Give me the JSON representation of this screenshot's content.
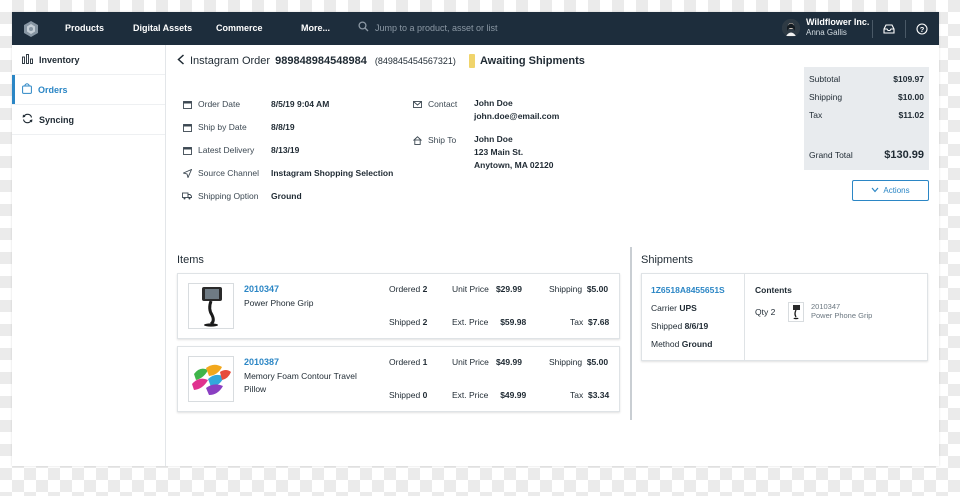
{
  "topbar": {
    "nav": [
      "Products",
      "Digital Assets",
      "Commerce",
      "More..."
    ],
    "search_placeholder": "Jump to a product, asset or list",
    "account_name": "Wildflower Inc.",
    "account_user": "Anna Gallis",
    "icons": [
      "logo-icon",
      "search-icon",
      "inbox-icon",
      "help-icon"
    ]
  },
  "sidebar": {
    "items": [
      {
        "label": "Inventory",
        "icon": "inventory-icon"
      },
      {
        "label": "Orders",
        "icon": "orders-bag-icon",
        "active": true
      },
      {
        "label": "Syncing",
        "icon": "sync-icon"
      }
    ]
  },
  "order": {
    "prefix": "Instagram Order",
    "number": "989848984548984",
    "alt_number": "(849845454567321)",
    "status": "Awaiting Shipments",
    "status_color": "#f0d46b",
    "details": [
      {
        "label": "Order Date",
        "value": "8/5/19 9:04 AM",
        "icon": "calendar-icon"
      },
      {
        "label": "Ship by Date",
        "value": "8/8/19",
        "icon": "calendar-icon"
      },
      {
        "label": "Latest Delivery",
        "value": "8/13/19",
        "icon": "calendar-icon"
      },
      {
        "label": "Source Channel",
        "value": "Instagram Shopping Selection",
        "icon": "send-icon"
      },
      {
        "label": "Shipping Option",
        "value": "Ground",
        "icon": "truck-icon"
      }
    ],
    "contact": {
      "label": "Contact",
      "name": "John Doe",
      "email": "john.doe@email.com"
    },
    "ship_to": {
      "label": "Ship To",
      "name": "John Doe",
      "street": "123 Main St.",
      "city": "Anytown, MA 02120"
    }
  },
  "totals": {
    "subtotal_label": "Subtotal",
    "subtotal": "$109.97",
    "shipping_label": "Shipping",
    "shipping": "$10.00",
    "tax_label": "Tax",
    "tax": "$11.02",
    "grand_label": "Grand Total",
    "grand": "$130.99"
  },
  "actions_label": "Actions",
  "items_title": "Items",
  "items": [
    {
      "sku": "2010347",
      "name": "Power Phone Grip",
      "ordered_label": "Ordered",
      "ordered": "2",
      "shipped_label": "Shipped",
      "shipped": "2",
      "unit_label": "Unit Price",
      "unit": "$29.99",
      "ext_label": "Ext. Price",
      "ext": "$59.98",
      "shipping_label": "Shipping",
      "shipping": "$5.00",
      "tax_label": "Tax",
      "tax": "$7.68"
    },
    {
      "sku": "2010387",
      "name": "Memory Foam Contour Travel Pillow",
      "ordered_label": "Ordered",
      "ordered": "1",
      "shipped_label": "Shipped",
      "shipped": "0",
      "unit_label": "Unit Price",
      "unit": "$49.99",
      "ext_label": "Ext. Price",
      "ext": "$49.99",
      "shipping_label": "Shipping",
      "shipping": "$5.00",
      "tax_label": "Tax",
      "tax": "$3.34"
    }
  ],
  "shipments_title": "Shipments",
  "shipment": {
    "tracking": "1Z6518A8455651S",
    "carrier_label": "Carrier",
    "carrier": "UPS",
    "shipped_label": "Shipped",
    "shipped": "8/6/19",
    "method_label": "Method",
    "method": "Ground",
    "contents_label": "Contents",
    "qty": "Qty 2",
    "item_sku": "2010347",
    "item_name": "Power Phone Grip"
  },
  "colors": {
    "nav_bg": "#1d2d3c",
    "accent": "#2b86c5",
    "totals_bg": "#e8ebee"
  }
}
